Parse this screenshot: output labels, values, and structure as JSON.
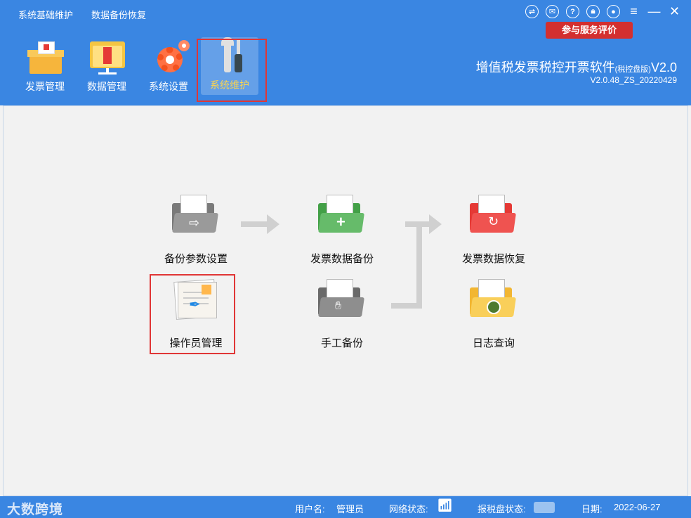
{
  "top_links": [
    "系统基础维护",
    "数据备份恢复"
  ],
  "window_icons": [
    "sync-icon",
    "feedback-icon",
    "help-icon",
    "lock-icon",
    "user-icon",
    "menu-icon",
    "minimize-icon",
    "close-icon"
  ],
  "service_button": "参与服务评价",
  "nav": [
    {
      "label": "发票管理",
      "icon": "invoice-box-icon"
    },
    {
      "label": "数据管理",
      "icon": "data-folder-icon"
    },
    {
      "label": "系统设置",
      "icon": "gear-icon"
    },
    {
      "label": "系统维护",
      "icon": "tools-icon",
      "active": true
    }
  ],
  "app": {
    "title": "增值税发票税控开票软件",
    "edition": "(税控盘版)",
    "title_suffix": "V2.0",
    "version": "V2.0.48_ZS_20220429"
  },
  "functions": {
    "backup_settings": "备份参数设置",
    "invoice_backup": "发票数据备份",
    "invoice_restore": "发票数据恢复",
    "operator_management": "操作员管理",
    "manual_backup": "手工备份",
    "log_query": "日志查询"
  },
  "status": {
    "logo": "大数跨境",
    "user_label": "用户名:",
    "user_value": "管理员",
    "network_label": "网络状态:",
    "disk_label": "报税盘状态:",
    "date_label": "日期:",
    "date_value": "2022-06-27"
  },
  "colors": {
    "primary": "#3a86e2",
    "highlight": "#e03636",
    "active_label": "#ffd54a"
  }
}
